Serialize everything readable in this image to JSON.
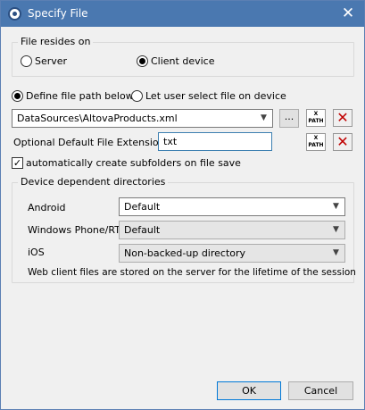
{
  "window": {
    "title": "Specify File",
    "close_glyph": "✕"
  },
  "file_location": {
    "legend": "File resides on",
    "options": [
      {
        "label": "Server",
        "selected": false
      },
      {
        "label": "Client device",
        "selected": true
      }
    ]
  },
  "path_mode": {
    "options": [
      {
        "label": "Define file path below",
        "selected": true
      },
      {
        "label": "Let user select file on device",
        "selected": false
      }
    ]
  },
  "file_path": {
    "value": "DataSources\\AltovaProducts.xml",
    "browse_label": "..."
  },
  "extension": {
    "label": "Optional Default File Extension",
    "value": "txt"
  },
  "xpath_icon": {
    "line1": "X",
    "line2": "PATH"
  },
  "delete_glyph": "✕",
  "subfolders": {
    "label": "automatically create subfolders on file save",
    "checked": true,
    "check_glyph": "✓"
  },
  "device_dirs": {
    "legend": "Device dependent directories",
    "rows": [
      {
        "label": "Android",
        "value": "Default"
      },
      {
        "label": "Windows Phone/RT",
        "value": "Default"
      },
      {
        "label": "iOS",
        "value": "Non-backed-up directory"
      }
    ],
    "note": "Web client files are stored on the server for the lifetime of the session"
  },
  "footer": {
    "ok_label": "OK",
    "cancel_label": "Cancel"
  },
  "colors": {
    "titlebar": "#4a78b0",
    "delete_icon": "#c00000",
    "default_button_border": "#0078d7"
  },
  "icons": {
    "app": "altova-app-icon",
    "close": "close-icon",
    "xpath": "xpath-icon",
    "delete": "delete-icon",
    "dropdown": "chevron-down-icon"
  }
}
